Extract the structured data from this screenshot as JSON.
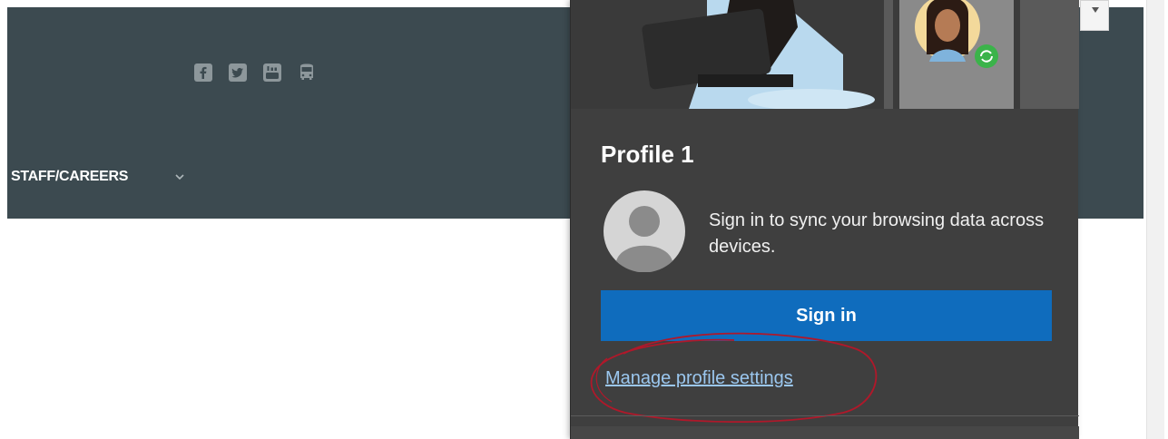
{
  "website": {
    "social_icons": [
      "facebook-icon",
      "twitter-icon",
      "youtube-icon",
      "bus-icon"
    ],
    "nav_item": "STAFF/CAREERS"
  },
  "profile_flyout": {
    "title": "Profile 1",
    "sync_message": "Sign in to sync your browsing data across devices.",
    "sign_in_label": "Sign in",
    "manage_link": "Manage profile settings"
  },
  "colors": {
    "header_bg": "#3c4a50",
    "flyout_bg": "#3f3f3f",
    "button_blue": "#0f6cbd",
    "link_color": "#9bc7ef",
    "annotation_red": "#b0182a"
  }
}
